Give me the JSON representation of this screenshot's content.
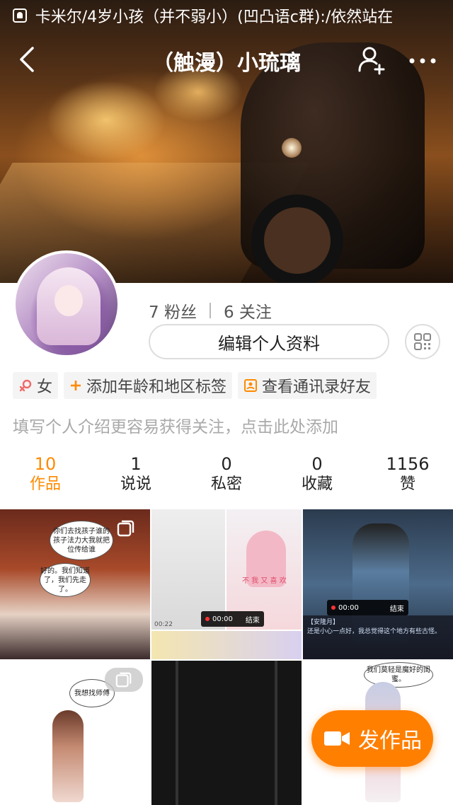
{
  "status_bar": {
    "notification_text": "卡米尔/4岁小孩（并不弱小）(凹凸语c群):/依然站在"
  },
  "nav": {
    "title": "（触漫）小琉璃"
  },
  "profile": {
    "followers_count": "7",
    "followers_label": "粉丝",
    "following_count": "6",
    "following_label": "关注",
    "edit_button": "编辑个人资料",
    "tags": {
      "gender": "女",
      "add_age_region": "添加年龄和地区标签",
      "view_contacts": "查看通讯录好友"
    },
    "bio_placeholder": "填写个人介绍更容易获得关注，点击此处添加"
  },
  "tabs": [
    {
      "count": "10",
      "label": "作品",
      "active": true
    },
    {
      "count": "1",
      "label": "说说",
      "active": false
    },
    {
      "count": "0",
      "label": "私密",
      "active": false
    },
    {
      "count": "0",
      "label": "收藏",
      "active": false
    },
    {
      "count": "1156",
      "label": "赞",
      "active": false
    }
  ],
  "grid": {
    "c1": {
      "bubble1": "你们去找孩子谁的孩子法力大我就把位传给谁",
      "bubble2": "好的。我们知道了，我们先走了。"
    },
    "c2": {
      "rec_time": "00:00",
      "rec_end": "结束",
      "time_left": "00:22",
      "pink_text": "不 我 又 喜 欢"
    },
    "c3": {
      "rec_time": "00:00",
      "rec_end": "结束",
      "speaker": "【安隆月】",
      "dialog": "还是小心一点好，我总觉得这个地方有些古怪。"
    },
    "c4": {
      "bubble": "我想找师傅"
    },
    "c6": {
      "bubble": "我们莫轻是魔好的闺蜜。"
    }
  },
  "fab": {
    "label": "发作品"
  },
  "colors": {
    "accent": "#ff7f00",
    "tab_active": "#ff8a00"
  },
  "icons": [
    "notification-icon",
    "back-icon",
    "add-friend-icon",
    "more-icon",
    "qr-code-icon",
    "female-icon",
    "plus-icon",
    "contacts-icon",
    "multi-image-icon",
    "video-camera-icon"
  ]
}
